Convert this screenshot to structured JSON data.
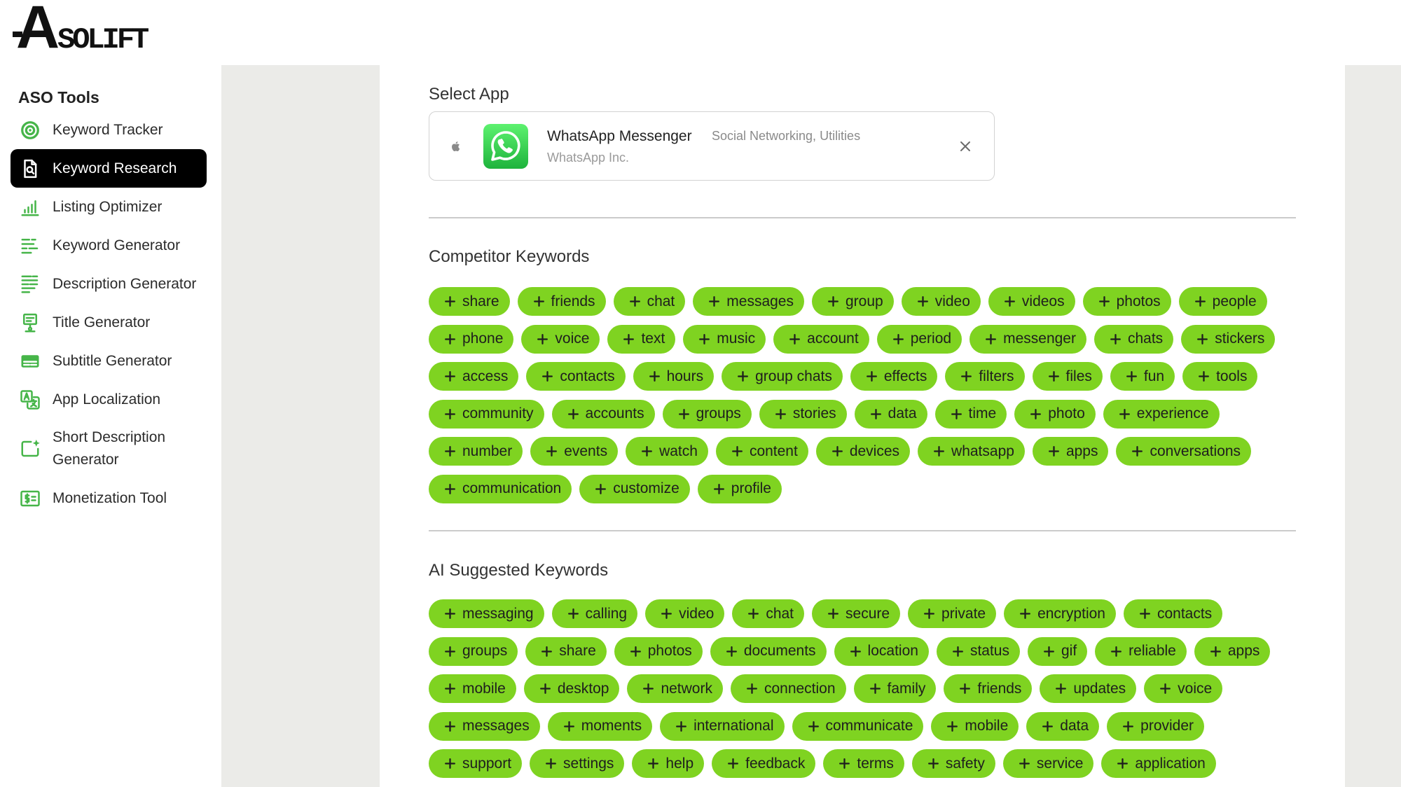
{
  "brand": "ASOLIFT",
  "colors": {
    "keyword_chip": "#7fd321",
    "icon_green": "#46b549",
    "active_nav": "#000000",
    "page_background": "#ebebe8"
  },
  "sidebar": {
    "heading": "ASO Tools",
    "items": [
      {
        "label": "Keyword Tracker",
        "icon": "target-icon",
        "active": false
      },
      {
        "label": "Keyword Research",
        "icon": "search-document-icon",
        "active": true
      },
      {
        "label": "Listing Optimizer",
        "icon": "bar-chart-icon",
        "active": false
      },
      {
        "label": "Keyword Generator",
        "icon": "text-lines-icon",
        "active": false
      },
      {
        "label": "Description Generator",
        "icon": "paragraph-icon",
        "active": false
      },
      {
        "label": "Title Generator",
        "icon": "presentation-board-icon",
        "active": false
      },
      {
        "label": "Subtitle Generator",
        "icon": "subtitles-icon",
        "active": false
      },
      {
        "label": "App Localization",
        "icon": "translate-icon",
        "active": false
      },
      {
        "label": "Short Description Generator",
        "icon": "sparkle-card-icon",
        "active": false
      },
      {
        "label": "Monetization Tool",
        "icon": "dollar-card-icon",
        "active": false
      }
    ]
  },
  "select_app": {
    "label": "Select App",
    "app": {
      "platform_icon": "apple-icon",
      "icon": "whatsapp-icon",
      "name": "WhatsApp Messenger",
      "categories": "Social Networking, Utilities",
      "developer": "WhatsApp Inc.",
      "clear_icon": "close-icon"
    }
  },
  "competitor_keywords": {
    "title": "Competitor Keywords",
    "chip_icon": "plus-icon",
    "rows": [
      [
        "share",
        "friends",
        "chat",
        "messages",
        "group",
        "video",
        "videos",
        "photos",
        "people"
      ],
      [
        "phone",
        "voice",
        "text",
        "music",
        "account",
        "period",
        "messenger",
        "chats",
        "stickers"
      ],
      [
        "access",
        "contacts",
        "hours",
        "group chats",
        "effects",
        "filters",
        "files",
        "fun",
        "tools"
      ],
      [
        "community",
        "accounts",
        "groups",
        "stories",
        "data",
        "time",
        "photo",
        "experience"
      ],
      [
        "number",
        "events",
        "watch",
        "content",
        "devices",
        "whatsapp",
        "apps",
        "conversations"
      ],
      [
        "communication",
        "customize",
        "profile"
      ]
    ]
  },
  "ai_suggested_keywords": {
    "title": "AI Suggested Keywords",
    "chip_icon": "plus-icon",
    "rows": [
      [
        "messaging",
        "calling",
        "video",
        "chat",
        "secure",
        "private",
        "encryption",
        "contacts"
      ],
      [
        "groups",
        "share",
        "photos",
        "documents",
        "location",
        "status",
        "gif",
        "reliable",
        "apps"
      ],
      [
        "mobile",
        "desktop",
        "network",
        "connection",
        "family",
        "friends",
        "updates",
        "voice"
      ],
      [
        "messages",
        "moments",
        "international",
        "communicate",
        "mobile",
        "data",
        "provider"
      ],
      [
        "support",
        "settings",
        "help",
        "feedback",
        "terms",
        "safety",
        "service",
        "application"
      ]
    ]
  }
}
